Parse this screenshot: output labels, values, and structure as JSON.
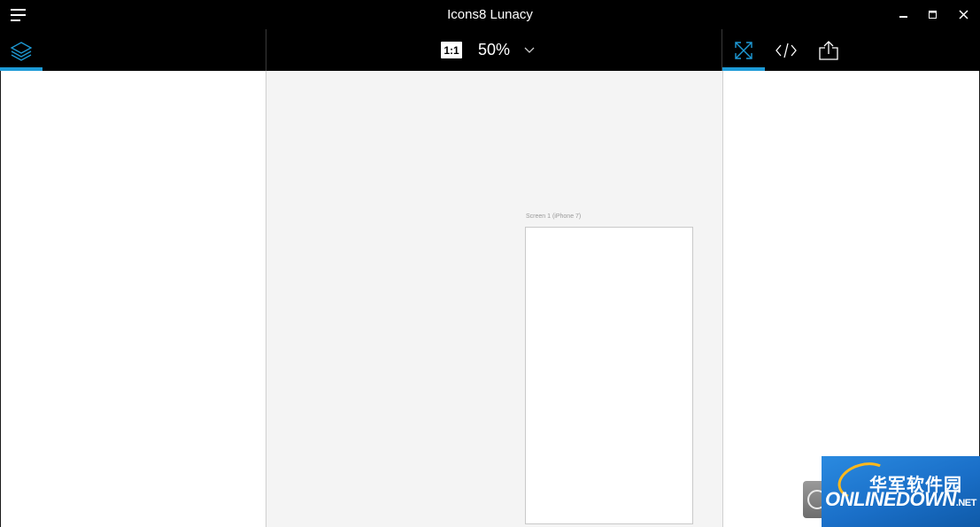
{
  "window": {
    "title": "Icons8 Lunacy",
    "menu_icon": "hamburger-menu-icon",
    "minimize_icon": "minimize-icon",
    "maximize_icon": "maximize-icon",
    "close_icon": "close-icon"
  },
  "toolbar": {
    "layers_tab_icon": "layers-icon",
    "actual_size_label": "1:1",
    "zoom_value": "50%",
    "zoom_dropdown_icon": "chevron-down-icon",
    "right_tabs": [
      {
        "icon": "fit-screen-icon",
        "active": true
      },
      {
        "icon": "code-icon",
        "active": false
      },
      {
        "icon": "export-icon",
        "active": false
      }
    ]
  },
  "canvas": {
    "artboard_label": "Screen 1 (iPhone 7)"
  },
  "watermark": {
    "brand_cn": "华军软件园",
    "brand_en": "ONLINEDOWN",
    "brand_suffix": ".NET"
  },
  "colors": {
    "accent": "#1e9bd7",
    "chrome_bg": "#000000",
    "canvas_bg": "#f4f4f4",
    "panel_bg": "#ffffff"
  }
}
